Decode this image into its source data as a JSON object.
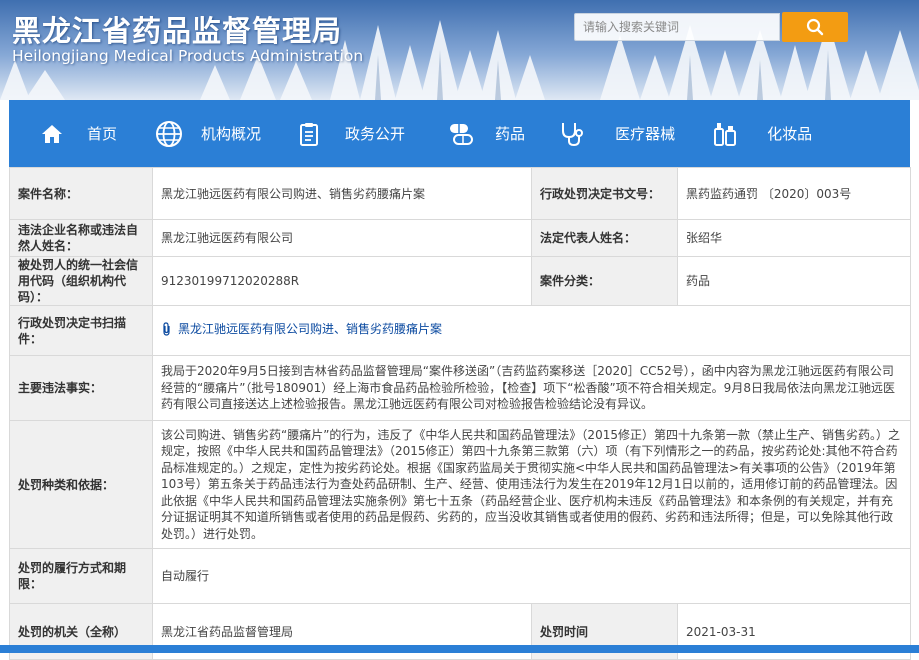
{
  "header": {
    "title_cn": "黑龙江省药品监督管理局",
    "title_en": "Heilongjiang Medical Products Administration",
    "search_placeholder": "请输入搜索关键词"
  },
  "nav": {
    "items": [
      {
        "label": "首页",
        "icon": "home-icon"
      },
      {
        "label": "机构概况",
        "icon": "globe-icon"
      },
      {
        "label": "政务公开",
        "icon": "clipboard-icon"
      },
      {
        "label": "药品",
        "icon": "pill-icon"
      },
      {
        "label": "医疗器械",
        "icon": "stethoscope-icon"
      },
      {
        "label": "化妆品",
        "icon": "cosmetics-icon"
      }
    ]
  },
  "record": {
    "case_name_label": "案件名称：",
    "case_name": "黑龙江驰远医药有限公司购进、销售劣药腰痛片案",
    "decision_no_label": "行政处罚决定书文号：",
    "decision_no": "黑药监药通罚 〔2020〕003号",
    "company_label": "违法企业名称或违法自然人姓名：",
    "company": "黑龙江驰远医药有限公司",
    "legal_rep_label": "法定代表人姓名：",
    "legal_rep": "张绍华",
    "credit_code_label": "被处罚人的统一社会信用代码（组织机构代码）：",
    "credit_code": "91230199712020288R",
    "category_label": "案件分类：",
    "category": "药品",
    "scan_label": "行政处罚决定书扫描件：",
    "scan_link": "黑龙江驰远医药有限公司购进、销售劣药腰痛片案",
    "facts_label": "主要违法事实：",
    "facts": "我局于2020年9月5日接到吉林省药品监督管理局“案件移送函”（吉药监药案移送［2020］CC52号），函中内容为黑龙江驰远医药有限公司经营的“腰痛片”（批号180901）经上海市食品药品检验所检验，【检查】项下“松香酸”项不符合相关规定。9月8日我局依法向黑龙江驰远医药有限公司直接送达上述检验报告。黑龙江驰远医药有限公司对检验报告检验结论没有异议。",
    "basis_label": "处罚种类和依据：",
    "basis": "该公司购进、销售劣药“腰痛片”的行为，违反了《中华人民共和国药品管理法》（2015修正）第四十九条第一款（禁止生产、销售劣药。）之规定，按照《中华人民共和国药品管理法》（2015修正）第四十九条第三款第（六）项（有下列情形之一的药品，按劣药论处:其他不符合药品标准规定的。）之规定，定性为按劣药论处。根据《国家药监局关于贯彻实施<中华人民共和国药品管理法>有关事项的公告》（2019年第103号）第五条关于药品违法行为查处药品研制、生产、经营、使用违法行为发生在2019年12月1日以前的，适用修订前的药品管理法。因此依据《中华人民共和国药品管理法实施条例》第七十五条（药品经营企业、医疗机构未违反《药品管理法》和本条例的有关规定，并有充分证据证明其不知道所销售或者使用的药品是假药、劣药的，应当没收其销售或者使用的假药、劣药和违法所得；但是，可以免除其他行政处罚。）进行处罚。",
    "performance_label": "处罚的履行方式和期限：",
    "performance": "自动履行",
    "authority_label": "处罚的机关（全称）",
    "authority": "黑龙江省药品监督管理局",
    "date_label": "处罚时间",
    "date": "2021-03-31"
  }
}
